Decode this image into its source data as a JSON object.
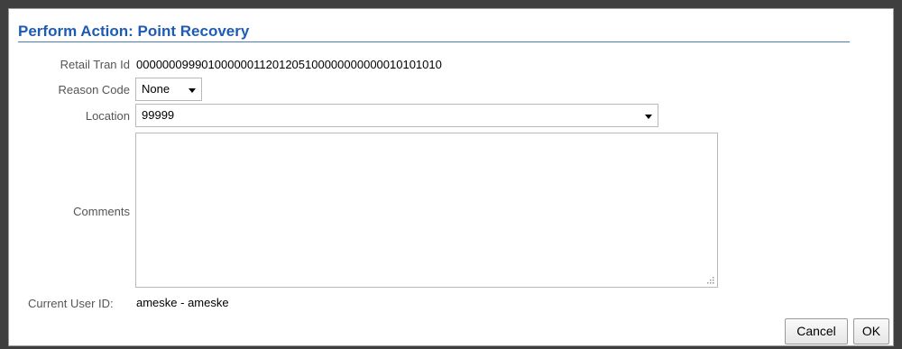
{
  "dialog": {
    "title": "Perform Action: Point Recovery"
  },
  "form": {
    "retail_tran_id": {
      "label": "Retail Tran Id",
      "value": "00000009990100000011201205100000000000010101010"
    },
    "reason_code": {
      "label": "Reason Code",
      "selected": "None"
    },
    "location": {
      "label": "Location",
      "selected": "99999"
    },
    "comments": {
      "label": "Comments",
      "value": ""
    },
    "current_user": {
      "label": "Current User ID:",
      "value": "ameske - ameske"
    }
  },
  "buttons": {
    "cancel": "Cancel",
    "ok": "OK"
  },
  "icons": {
    "dropdown": "chevron-down-icon",
    "resize": "resize-grip-icon"
  },
  "colors": {
    "title": "#1e5bb5",
    "title_rule": "#4a7bb5",
    "label": "#555555",
    "backdrop": "#3f3f3f"
  }
}
